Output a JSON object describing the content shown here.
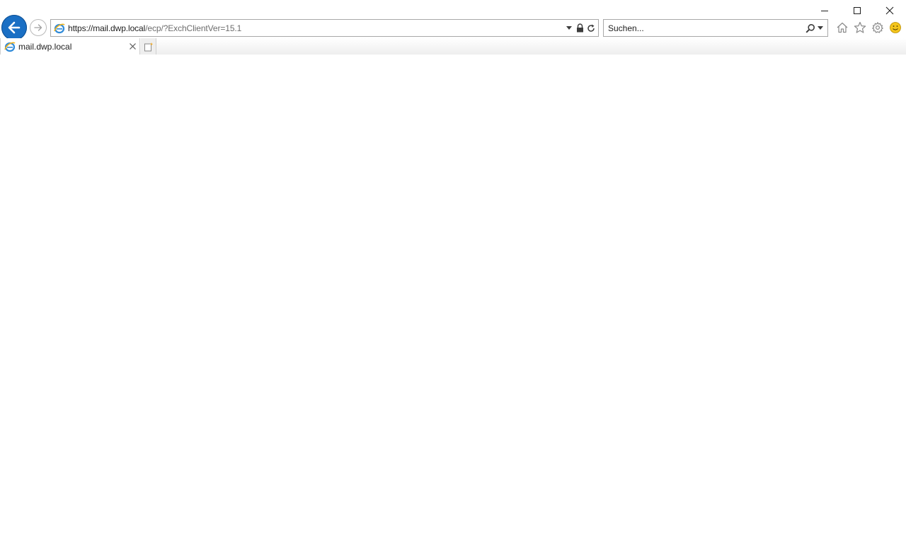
{
  "browser": {
    "name": "Internet Explorer",
    "accent_color": "#1a6fc4"
  },
  "window_controls": {
    "minimize_icon": "minimize-icon",
    "maximize_icon": "maximize-icon",
    "close_icon": "close-icon"
  },
  "navigation": {
    "back_icon": "back-arrow-icon",
    "forward_icon": "forward-arrow-icon"
  },
  "address_bar": {
    "scheme": "https://",
    "host": "mail.dwp.local",
    "path": "/ecp/?ExchClientVer=15.1",
    "icons": [
      "ie-favicon",
      "dropdown-icon",
      "lock-icon",
      "refresh-icon"
    ]
  },
  "search": {
    "placeholder": "Suchen...",
    "icons": [
      "search-icon",
      "dropdown-icon"
    ]
  },
  "toolbar": {
    "icons": [
      "home-icon",
      "favorites-star-icon",
      "settings-gear-icon",
      "feedback-smiley-icon"
    ]
  },
  "tabs": [
    {
      "title": "mail.dwp.local",
      "active": true
    }
  ],
  "new_tab_icon": "new-tab-icon"
}
